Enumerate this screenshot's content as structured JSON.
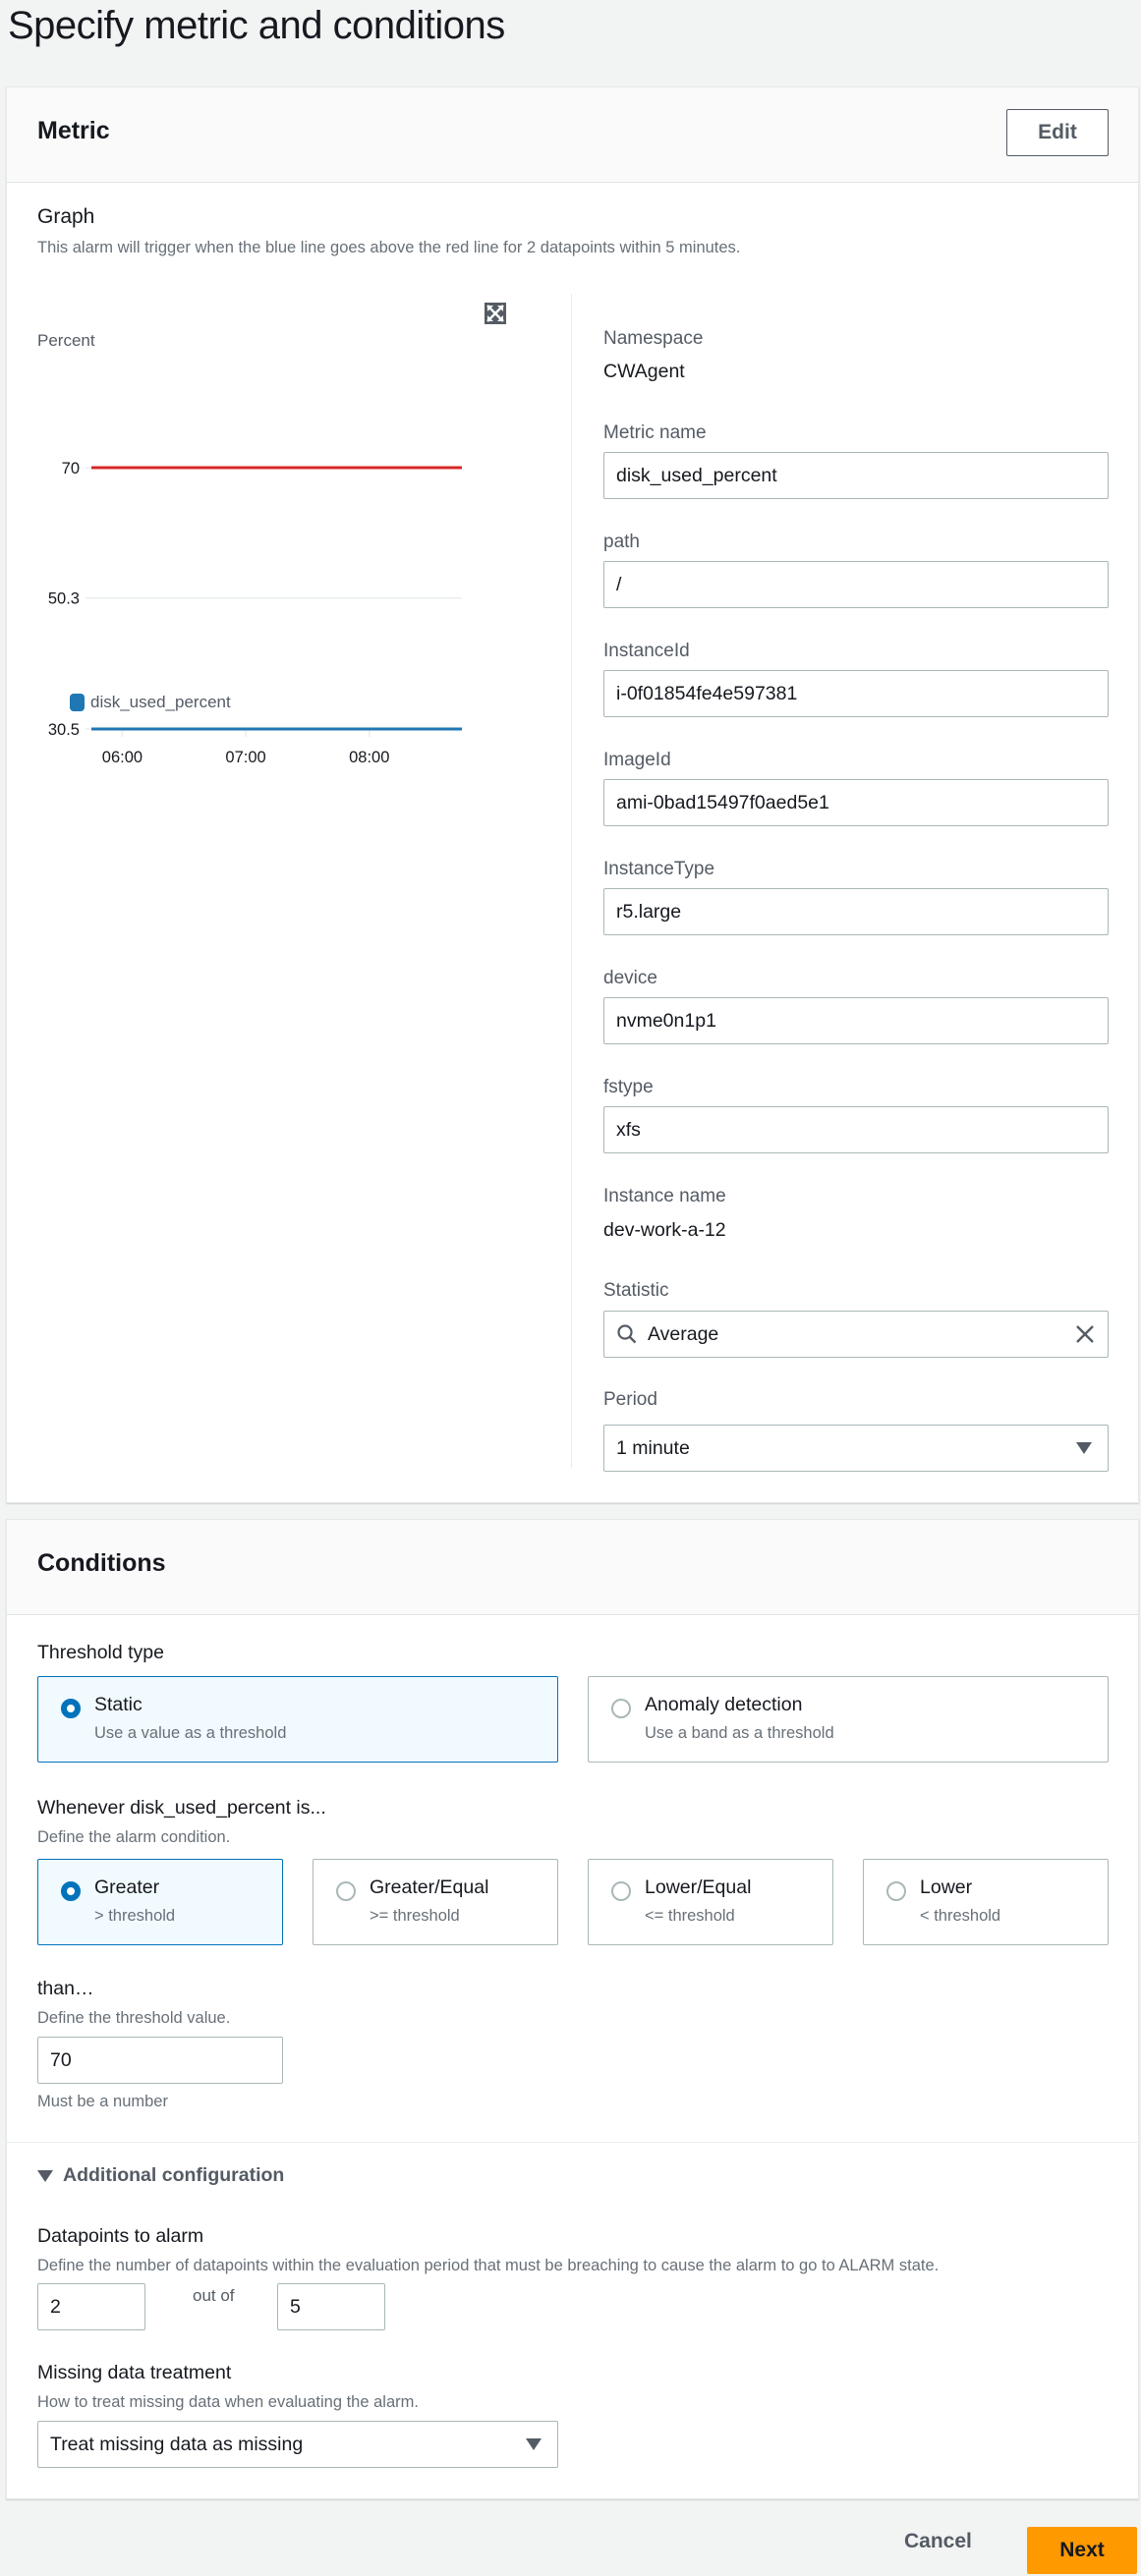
{
  "page": {
    "title": "Specify metric and conditions"
  },
  "metric": {
    "title": "Metric",
    "edit_label": "Edit",
    "graph": {
      "title": "Graph",
      "description": "This alarm will trigger when the blue line goes above the red line for 2 datapoints within 5 minutes."
    },
    "fields": {
      "namespace_label": "Namespace",
      "namespace_value": "CWAgent",
      "metric_name_label": "Metric name",
      "metric_name_value": "disk_used_percent",
      "path_label": "path",
      "path_value": "/",
      "instance_id_label": "InstanceId",
      "instance_id_value": "i-0f01854fe4e597381",
      "image_id_label": "ImageId",
      "image_id_value": "ami-0bad15497f0aed5e1",
      "instance_type_label": "InstanceType",
      "instance_type_value": "r5.large",
      "device_label": "device",
      "device_value": "nvme0n1p1",
      "fstype_label": "fstype",
      "fstype_value": "xfs",
      "instance_name_label": "Instance name",
      "instance_name_value": "dev-work-a-12",
      "statistic_label": "Statistic",
      "statistic_value": "Average",
      "period_label": "Period",
      "period_value": "1 minute"
    }
  },
  "chart_data": {
    "type": "line",
    "title": "",
    "ylabel": "Percent",
    "xlabel": "",
    "ylim": [
      30.5,
      70
    ],
    "y_ticks": [
      "70",
      "50.3",
      "30.5"
    ],
    "y_tick_values": [
      70,
      50.3,
      30.5
    ],
    "x_ticks": [
      "06:00",
      "07:00",
      "08:00"
    ],
    "x_range_hours": [
      5.75,
      8.75
    ],
    "grid": true,
    "legend_position": "bottom-left",
    "series": [
      {
        "name": "disk_used_percent",
        "color": "#1f77b4",
        "x": [
          "05:45",
          "08:45"
        ],
        "values": [
          30.5,
          30.5
        ],
        "in_legend": true
      },
      {
        "name": "threshold",
        "color": "#d62728",
        "x": [
          "05:45",
          "08:45"
        ],
        "values": [
          70,
          70
        ],
        "in_legend": false
      }
    ]
  },
  "conditions": {
    "title": "Conditions",
    "threshold_type": {
      "label": "Threshold type",
      "options": [
        {
          "title": "Static",
          "description": "Use a value as a threshold",
          "selected": true
        },
        {
          "title": "Anomaly detection",
          "description": "Use a band as a threshold",
          "selected": false
        }
      ]
    },
    "whenever": {
      "label": "Whenever disk_used_percent is...",
      "description": "Define the alarm condition.",
      "options": [
        {
          "title": "Greater",
          "description": "> threshold",
          "selected": true
        },
        {
          "title": "Greater/Equal",
          "description": ">= threshold",
          "selected": false
        },
        {
          "title": "Lower/Equal",
          "description": "<= threshold",
          "selected": false
        },
        {
          "title": "Lower",
          "description": "< threshold",
          "selected": false
        }
      ]
    },
    "than": {
      "label": "than…",
      "description": "Define the threshold value.",
      "value": "70",
      "hint": "Must be a number"
    },
    "additional": {
      "label": "Additional configuration",
      "datapoints": {
        "label": "Datapoints to alarm",
        "description": "Define the number of datapoints within the evaluation period that must be breaching to cause the alarm to go to ALARM state.",
        "value": "2",
        "out_of_label": "out of",
        "out_of_value": "5"
      },
      "missing": {
        "label": "Missing data treatment",
        "description": "How to treat missing data when evaluating the alarm.",
        "value": "Treat missing data as missing"
      }
    }
  },
  "footer": {
    "cancel_label": "Cancel",
    "next_label": "Next"
  }
}
